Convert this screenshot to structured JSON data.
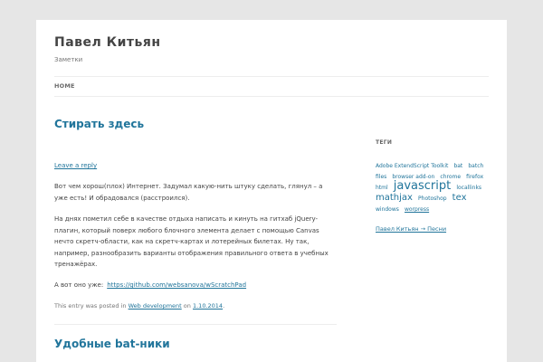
{
  "header": {
    "site_title": "Павел Китьян",
    "site_description": "Заметки"
  },
  "nav": {
    "items": [
      {
        "label": "HOME"
      }
    ]
  },
  "posts": [
    {
      "title": "Стирать здесь",
      "reply_link": "Leave a reply",
      "paragraphs": [
        "Вот чем хорош(плох) Интернет. Задумал какую-нить штуку сделать, глянул – а уже есть! И обрадовался (расстроился).",
        "На днях пометил себе в качестве отдыха написать и кинуть на гитхаб jQuery-плагин, который поверх любого блочного элемента делает с помощью Canvas нечто скретч-области, как на скретч-картах и лотерейных билетах. Ну так, например, разнообразить варианты отображения правильного ответа в учебных тренажёрах.",
        "А вот оно уже:"
      ],
      "link_text": "https://github.com/websanova/wScratchPad",
      "meta": {
        "prefix": "This entry was posted in",
        "category": "Web development",
        "on": "on",
        "date": "1.10.2014",
        "end": "."
      }
    },
    {
      "title": "Удобные bat-ники"
    }
  ],
  "sidebar": {
    "tags_title": "ТЕГИ",
    "tags": [
      {
        "label": "Adobe ExtendScript Toolkit",
        "size": "s"
      },
      {
        "label": "bat",
        "size": "s"
      },
      {
        "label": "batch files",
        "size": "s"
      },
      {
        "label": "browser add-on",
        "size": "s"
      },
      {
        "label": "chrome",
        "size": "s"
      },
      {
        "label": "firefox",
        "size": "s"
      },
      {
        "label": "html",
        "size": "s"
      },
      {
        "label": "javascript",
        "size": "l"
      },
      {
        "label": "locallinks",
        "size": "s"
      },
      {
        "label": "mathjax",
        "size": "m"
      },
      {
        "label": "Photoshop",
        "size": "s"
      },
      {
        "label": "tex",
        "size": "m"
      },
      {
        "label": "windows",
        "size": "s"
      },
      {
        "label": "worpress",
        "size": "s"
      }
    ],
    "blogroll_link": "Павел Китьян → Песни"
  },
  "colors": {
    "link": "#21759b",
    "text": "#444444",
    "background": "#e6e6e6",
    "page": "#ffffff"
  }
}
